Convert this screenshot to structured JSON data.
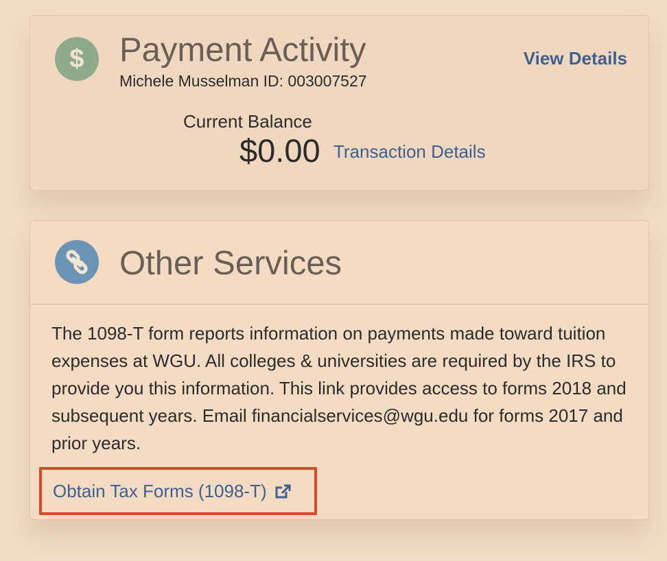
{
  "payment_activity": {
    "icon": "dollar-icon",
    "icon_symbol": "$",
    "title": "Payment Activity",
    "student_line": "Michele Musselman ID: 003007527",
    "view_details_label": "View Details",
    "balance_label": "Current Balance",
    "balance_value": "$0.00",
    "transaction_details_label": "Transaction Details"
  },
  "other_services": {
    "icon": "link-icon",
    "title": "Other Services",
    "description": "The 1098-T form reports information on payments made toward tuition expenses at WGU. All colleges & universities are required by the IRS to provide you this information. This link provides access to forms 2018 and subsequent years. Email financialservices@wgu.edu for forms 2017 and prior years.",
    "tax_forms_link_label": "Obtain Tax Forms (1098-T)",
    "tax_forms_link_icon": "external-link-icon"
  },
  "colors": {
    "background": "#f2dcc4",
    "link": "#3f5f8f",
    "dollar_icon": "#8fa98b",
    "link_icon": "#6b93b3",
    "highlight": "#d94a2c"
  }
}
